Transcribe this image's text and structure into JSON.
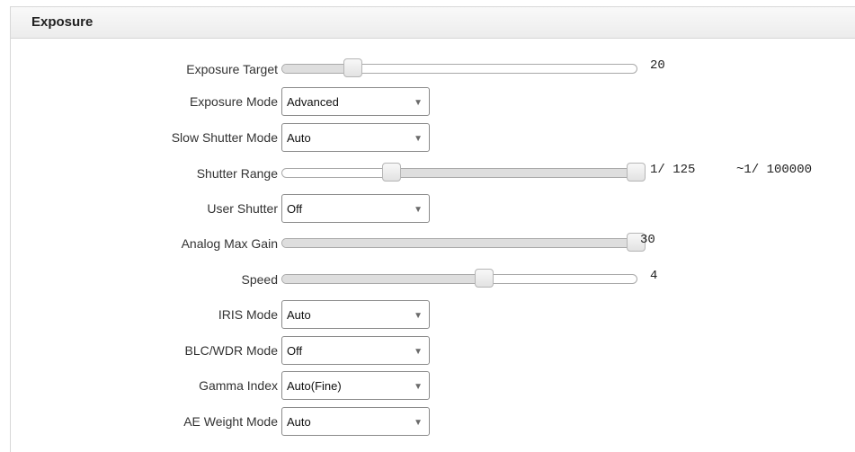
{
  "panel": {
    "title": "Exposure"
  },
  "rows": {
    "exposure_target": {
      "label": "Exposure Target",
      "value": "20",
      "level": 0.2
    },
    "exposure_mode": {
      "label": "Exposure Mode",
      "value": "Advanced"
    },
    "slow_shutter_mode": {
      "label": "Slow Shutter Mode",
      "value": "Auto"
    },
    "shutter_range": {
      "label": "Shutter Range",
      "min_value": "1/ 125",
      "max_value": "~1/ 100000",
      "low_level": 0.31,
      "high_level": 1.0
    },
    "user_shutter": {
      "label": "User Shutter",
      "value": "Off"
    },
    "analog_max_gain": {
      "label": "Analog Max Gain",
      "value": "30",
      "level": 1.0
    },
    "speed": {
      "label": "Speed",
      "value": "4",
      "level": 0.57
    },
    "iris_mode": {
      "label": "IRIS Mode",
      "value": "Auto"
    },
    "blc_wdr_mode": {
      "label": "BLC/WDR Mode",
      "value": "Off"
    },
    "gamma_index": {
      "label": "Gamma Index",
      "value": "Auto(Fine)"
    },
    "ae_weight_mode": {
      "label": "AE Weight Mode",
      "value": "Auto"
    }
  },
  "icons": {
    "dropdown_arrow": "triangle-down",
    "arrow_glyph": "▼"
  },
  "colors": {
    "header_bg": "#ececec",
    "track_fill": "#dedede",
    "border": "#a9a9a9"
  }
}
